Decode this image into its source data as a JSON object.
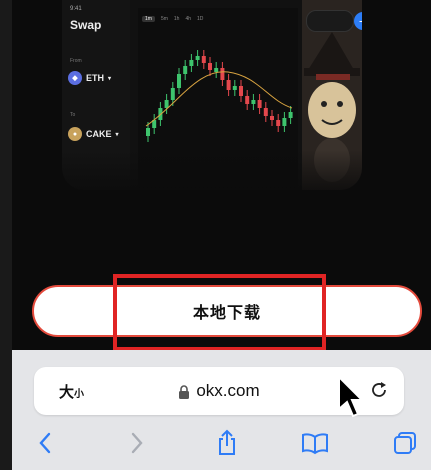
{
  "promo": {
    "time": "9:41",
    "swap_title": "Swap",
    "from_label": "From",
    "to_label": "To",
    "from_token": "ETH",
    "to_token": "CAKE",
    "chart_tabs": [
      "1m",
      "5m",
      "1h",
      "4h",
      "1D"
    ]
  },
  "download_button_label": "本地下载",
  "address_bar": {
    "text_size_label": "大",
    "text_size_small": "小",
    "url": "okx.com"
  },
  "colors": {
    "accent_red": "#e02424",
    "button_border": "#e34a3c",
    "safari_blue": "#2f7cf6",
    "bull_candle": "#3ec46d",
    "bear_candle": "#e5484d"
  }
}
